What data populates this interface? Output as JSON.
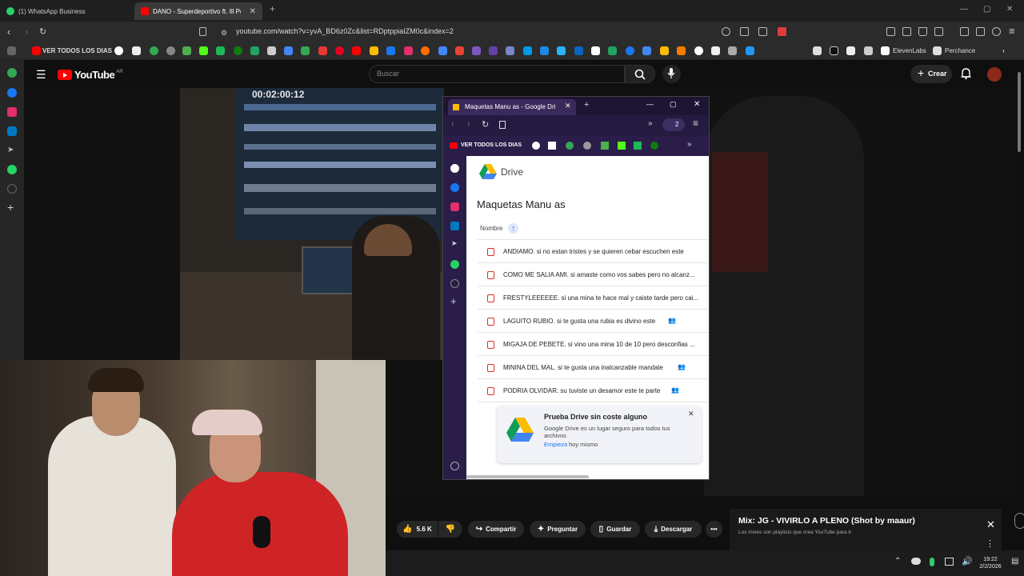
{
  "browser": {
    "tabs": [
      {
        "label": "(1) WhatsApp Business",
        "active": false
      },
      {
        "label": "DANO - Superdeportivo ft. Ill Pe",
        "active": true
      }
    ],
    "url": "youtube.com/watch?v=yvA_BD6z0Zc&list=RDptppiaIZM0c&index=2",
    "bookmarks": {
      "first": "VER TODOS LOS DIAS",
      "elevenlabs": "ElevenLabs",
      "perchance": "Perchance"
    }
  },
  "youtube": {
    "logo_text": "YouTube",
    "region": "AR",
    "search_placeholder": "Buscar",
    "create_label": "Crear"
  },
  "video": {
    "timecode": "00:02:00:12"
  },
  "inner_browser": {
    "tab_title": "Maquetas Manu as - Google Dri",
    "bookmark_first": "VER TODOS LOS DIAS",
    "badge": "2",
    "drive": {
      "app_name": "Drive",
      "folder_title": "Maquetas Manu as",
      "sort_label": "Nombre",
      "files": [
        {
          "name": "ANDIAMO. si no estan tristes y se quieren cebar escuchen este",
          "shared": true
        },
        {
          "name": "COMO ME SALIA AMI. si amaste como vos sabes pero no alcanz...",
          "shared": false
        },
        {
          "name": "FRESTYLEEEEEE. si una mina te hace mal y caiste tarde pero cai...",
          "shared": false
        },
        {
          "name": "LAGUITO RUBIO. si te gusta una rubia es divino este",
          "shared": true
        },
        {
          "name": "MIGAJA DE PEBETE. si vino una mina 10 de 10 pero desconfias ...",
          "shared": false
        },
        {
          "name": "MININA DEL MAL. si te gusta una inalcanzable mandale",
          "shared": true
        },
        {
          "name": "PODRIA OLVIDAR. su tuviste un desamor este te parte",
          "shared": true
        }
      ],
      "promo": {
        "title": "Prueba Drive sin coste alguno",
        "body": "Google Drive es un lugar seguro para todos tus archivos",
        "link": "Empieza",
        "link_suffix": "hoy mismo"
      }
    }
  },
  "actions": {
    "likes": "5.6 K",
    "share": "Compartir",
    "ask": "Preguntar",
    "save": "Guardar",
    "download": "Descargar"
  },
  "mix": {
    "title": "Mix: JG - VIVIRLO A PLENO (Shot by maaur)",
    "subtitle": "Los mixes son playlists que crea YouTube para ti"
  },
  "taskbar": {
    "time": "19:22",
    "date": "2/2/2026"
  }
}
